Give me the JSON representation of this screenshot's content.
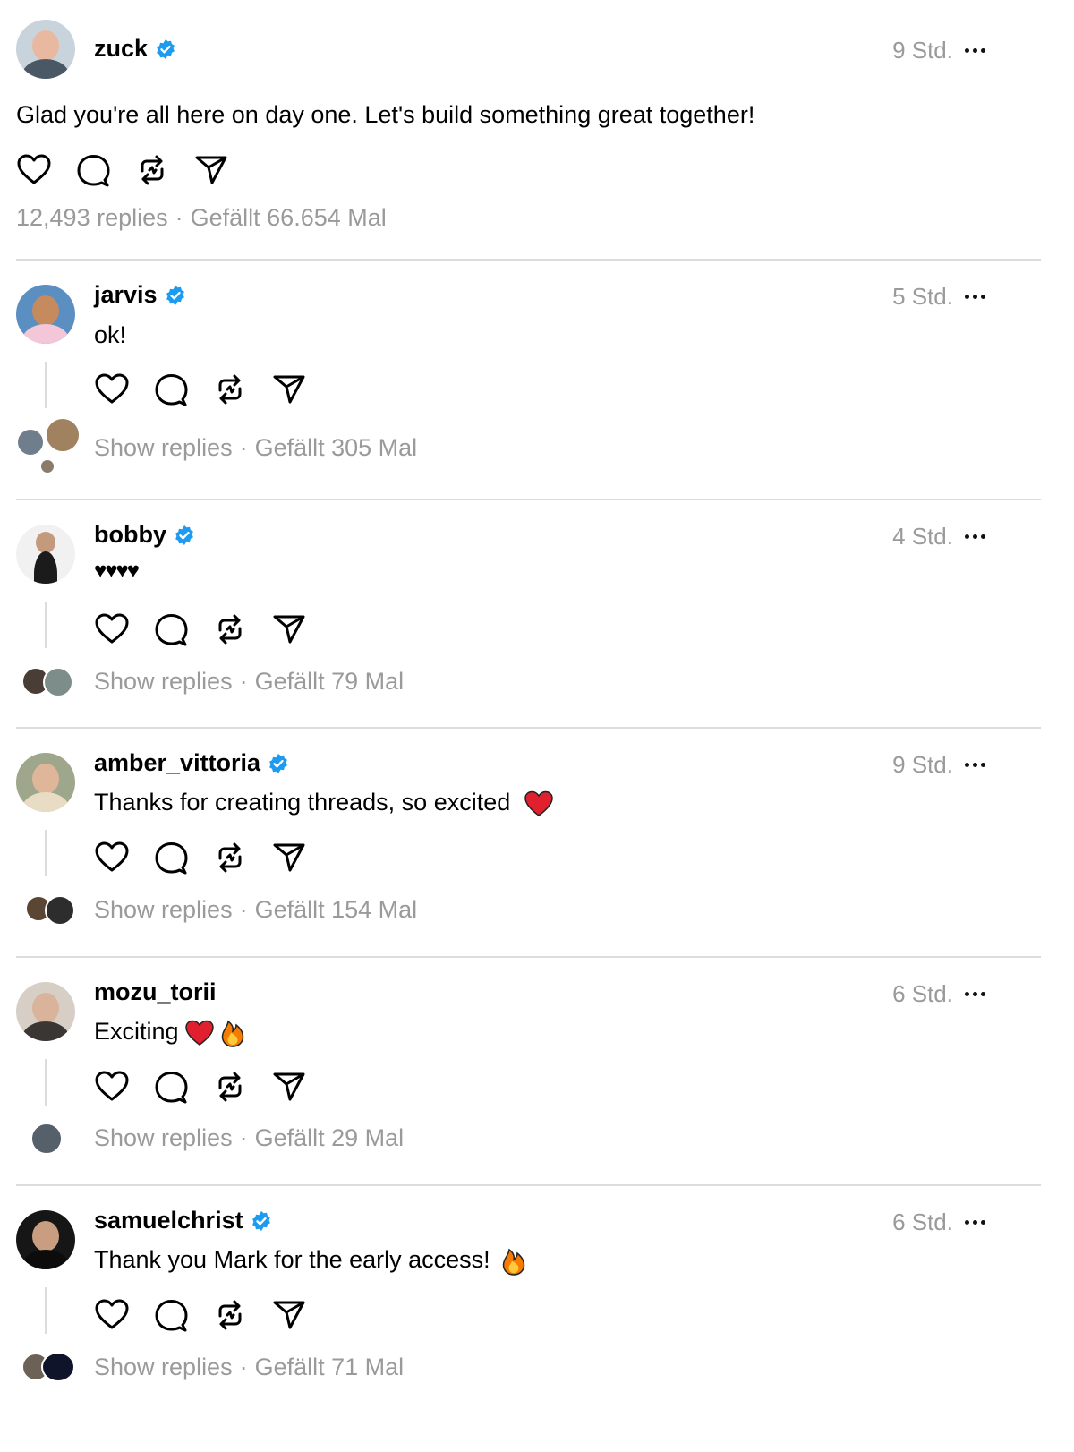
{
  "posts": [
    {
      "username": "zuck",
      "verified": true,
      "time": "9 Std.",
      "text": "Glad you're all here on day one. Let's build something great together!",
      "replies_label": "12,493 replies",
      "likes_label": "Gefällt 66.654 Mal"
    },
    {
      "username": "jarvis",
      "verified": true,
      "time": "5 Std.",
      "text": "ok!",
      "replies_label": "Show replies",
      "likes_label": "Gefällt 305 Mal"
    },
    {
      "username": "bobby",
      "verified": true,
      "time": "4 Std.",
      "text": "♥♥♥♥",
      "replies_label": "Show replies",
      "likes_label": "Gefällt 79 Mal"
    },
    {
      "username": "amber_vittoria",
      "verified": true,
      "time": "9 Std.",
      "text": "Thanks for creating threads, so excited",
      "replies_label": "Show replies",
      "likes_label": "Gefällt 154 Mal"
    },
    {
      "username": "mozu_torii",
      "verified": false,
      "time": "6 Std.",
      "text": "Exciting",
      "replies_label": "Show replies",
      "likes_label": "Gefällt 29 Mal"
    },
    {
      "username": "samuelchrist",
      "verified": true,
      "time": "6 Std.",
      "text": "Thank you Mark for the early access!",
      "replies_label": "Show replies",
      "likes_label": "Gefällt 71 Mal"
    }
  ],
  "icons": {
    "like": "heart-icon",
    "reply": "comment-icon",
    "repost": "repost-icon",
    "share": "send-icon",
    "more": "more-icon",
    "verified": "verified-badge-icon"
  },
  "colors": {
    "verified": "#1d9bf0",
    "muted": "#9a9a9a",
    "divider": "#dcdcdc",
    "heart_emoji": "#e0202e",
    "fire_emoji": "#f57c00"
  }
}
